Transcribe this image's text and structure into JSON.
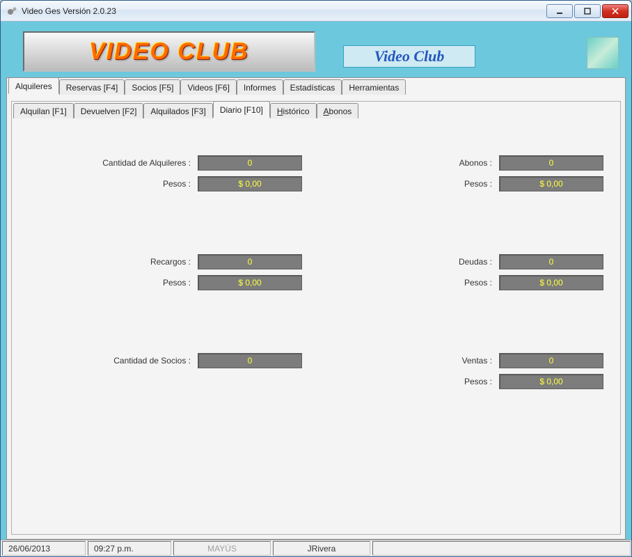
{
  "window": {
    "title": "Video Ges Versión 2.0.23"
  },
  "header": {
    "logo_text": "VIDEO CLUB",
    "brand": "Video Club"
  },
  "tabs_main": {
    "alquileres": "Alquileres",
    "reservas": "Reservas [F4]",
    "socios": "Socios [F5]",
    "videos": "Videos [F6]",
    "informes": "Informes",
    "estadisticas": "Estadísticas",
    "herramientas": "Herramientas"
  },
  "tabs_sub": {
    "alquilan": "Alquilan [F1]",
    "devuelven": "Devuelven [F2]",
    "alquilados": "Alquilados [F3]",
    "diario": "Diario [F10]",
    "historico_prefix": "H",
    "historico_rest": "istórico",
    "abonos_prefix": "A",
    "abonos_rest": "bonos"
  },
  "labels": {
    "cant_alquileres": "Cantidad de Alquileres :",
    "pesos": "Pesos :",
    "abonos": "Abonos :",
    "recargos": "Recargos :",
    "deudas": "Deudas :",
    "cant_socios": "Cantidad de Socios :",
    "ventas": "Ventas :"
  },
  "values": {
    "cant_alquileres": "0",
    "cant_alquileres_pesos": "$ 0,00",
    "abonos": "0",
    "abonos_pesos": "$ 0,00",
    "recargos": "0",
    "recargos_pesos": "$ 0,00",
    "deudas": "0",
    "deudas_pesos": "$ 0,00",
    "cant_socios": "0",
    "ventas": "0",
    "ventas_pesos": "$ 0,00"
  },
  "status": {
    "date": "26/06/2013",
    "time": "09:27 p.m.",
    "caps": "MAYÚS",
    "user": "JRivera"
  }
}
